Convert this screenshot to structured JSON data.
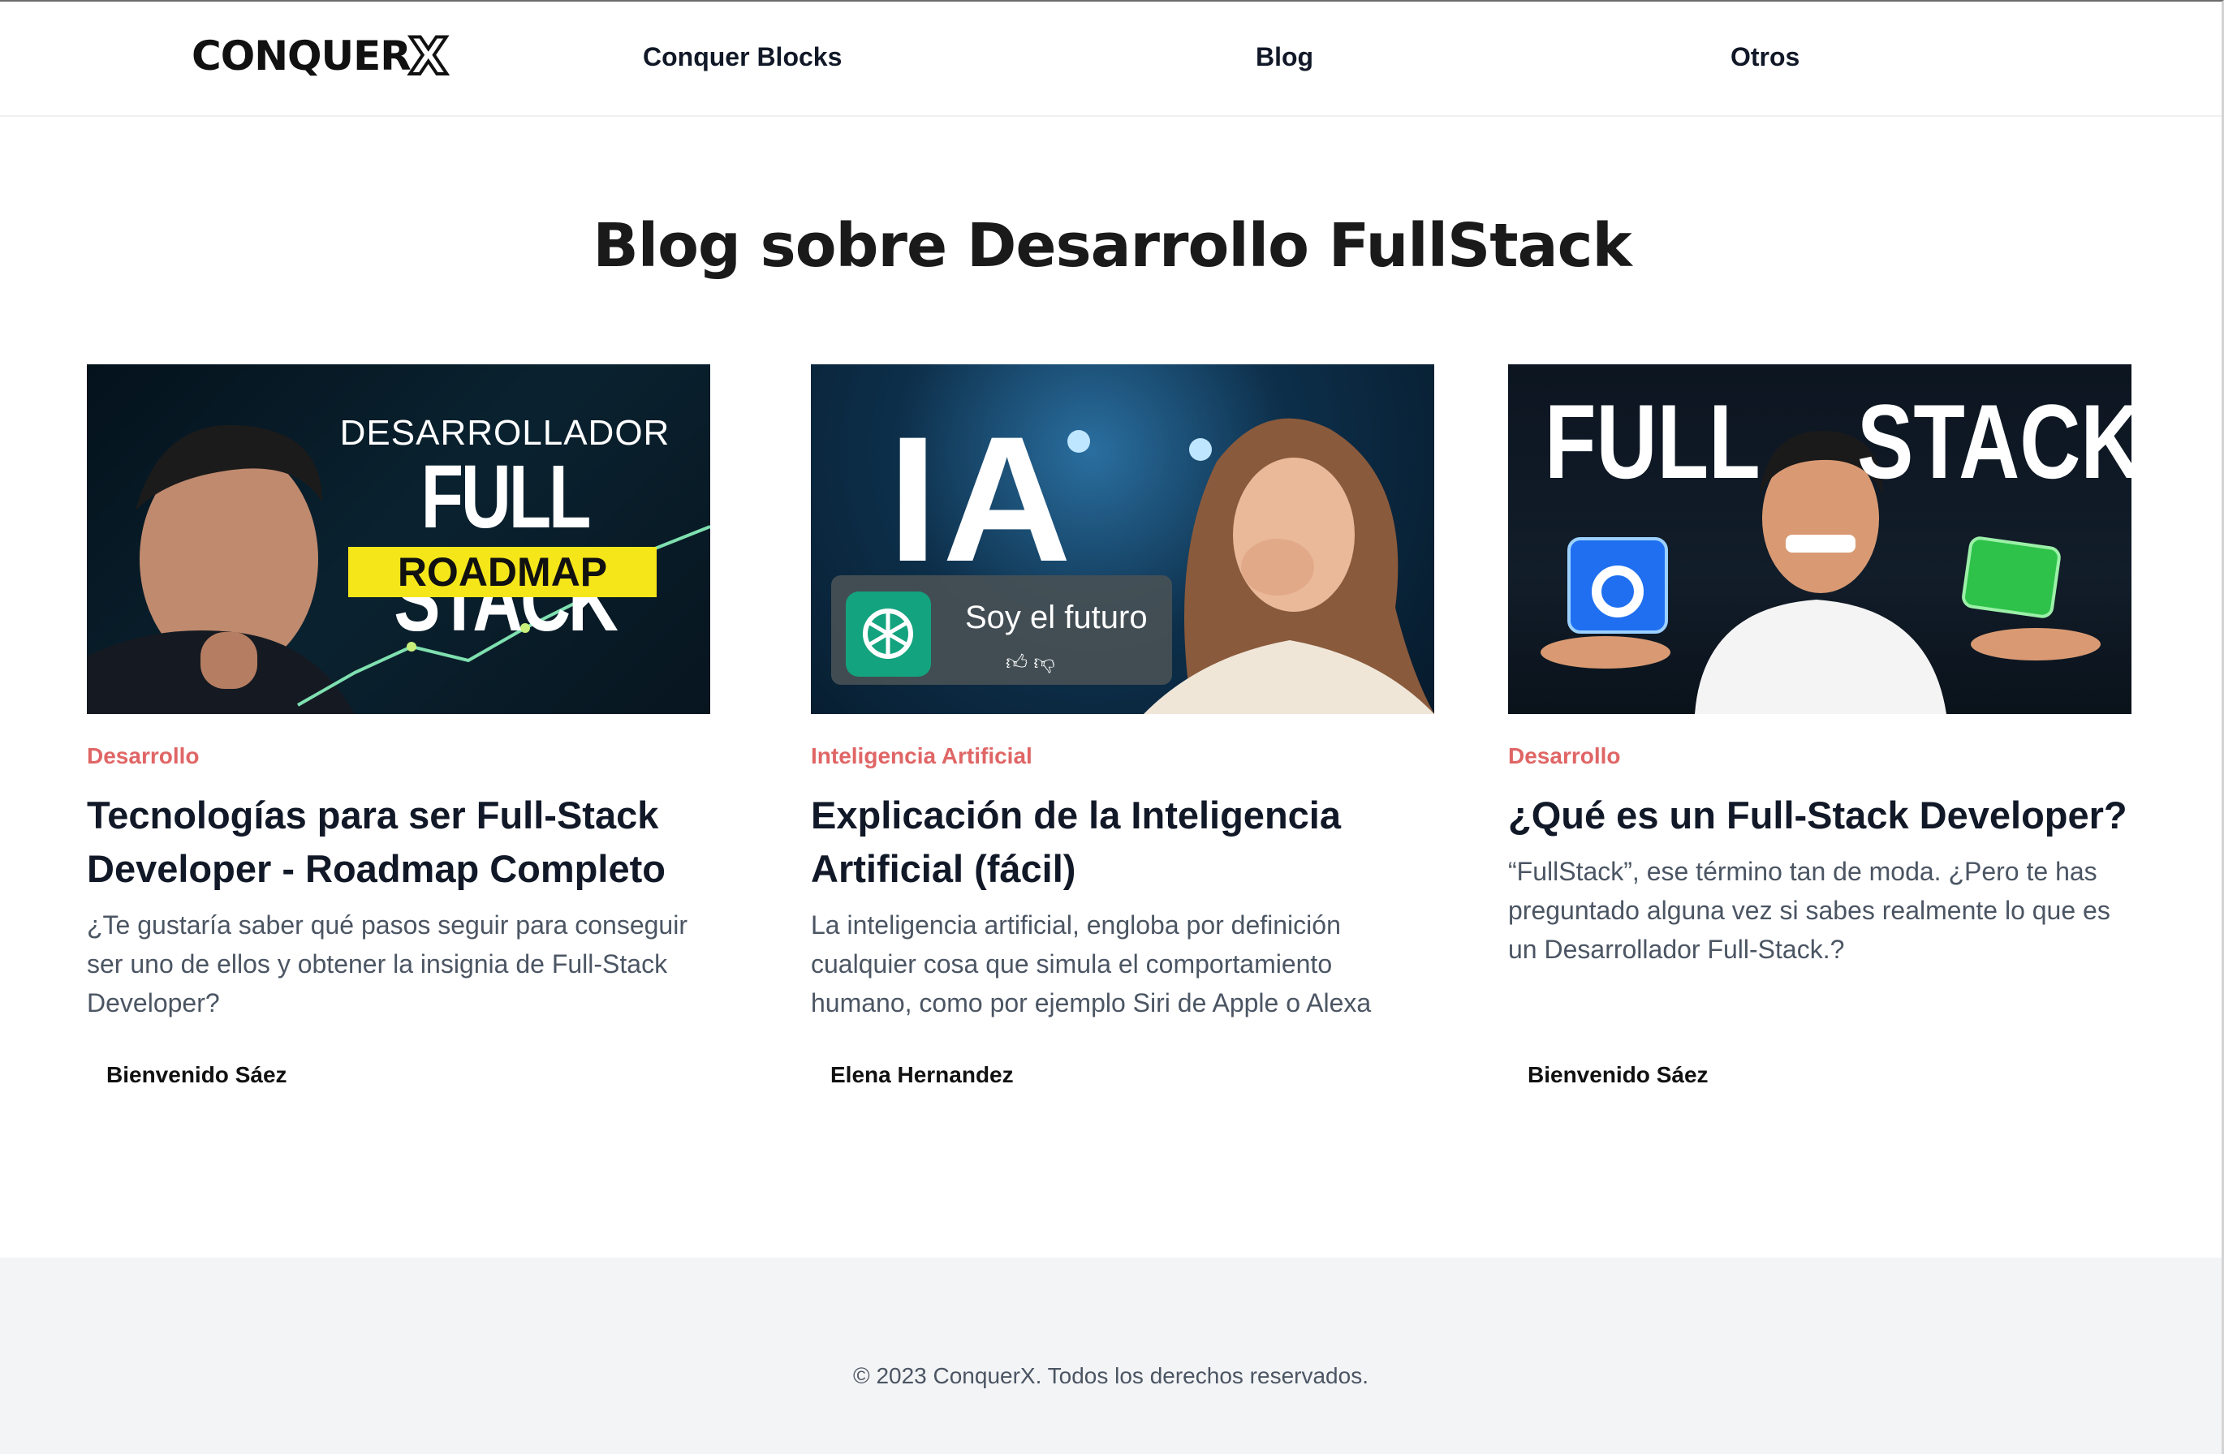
{
  "nav": {
    "logo_main": "CONQUER",
    "logo_x": "X",
    "links": [
      "Conquer Blocks",
      "Blog",
      "Otros"
    ]
  },
  "page": {
    "title": "Blog sobre Desarrollo FullStack"
  },
  "posts": [
    {
      "category": "Desarrollo",
      "title": "Tecnologías para ser Full-Stack Developer - Roadmap Completo",
      "excerpt": "¿Te gustaría saber qué pasos seguir para conseguir ser uno de ellos y obtener la insignia de Full-Stack Developer?",
      "author": "Bienvenido Sáez",
      "thumb": {
        "line1": "DESARROLLADOR",
        "line2": "FULL STACK",
        "badge": "ROADMAP"
      }
    },
    {
      "category": "Inteligencia Artificial",
      "title": "Explicación de la Inteligencia Artificial (fácil)",
      "excerpt": "La inteligencia artificial, engloba por definición cualquier cosa que simula el comportamiento humano, como por ejemplo Siri de Apple o Alexa",
      "author": "Elena Hernandez",
      "thumb": {
        "big": "IA",
        "chat": "Soy el futuro"
      }
    },
    {
      "category": "Desarrollo",
      "title": "¿Qué es un Full-Stack Developer?",
      "excerpt": "“FullStack”, ese término tan de moda. ¿Pero te has preguntado alguna vez si sabes realmente lo que es un Desarrollador Full-Stack.?",
      "author": "Bienvenido Sáez",
      "thumb": {
        "left": "FULL",
        "right": "STACK"
      }
    }
  ],
  "footer": {
    "text": "© 2023 ConquerX. Todos los derechos reservados."
  },
  "colors": {
    "category": "#e06666",
    "footer_bg": "#f3f4f6",
    "roadmap_badge": "#f5e61a",
    "chatgpt_green": "#14a37f"
  }
}
